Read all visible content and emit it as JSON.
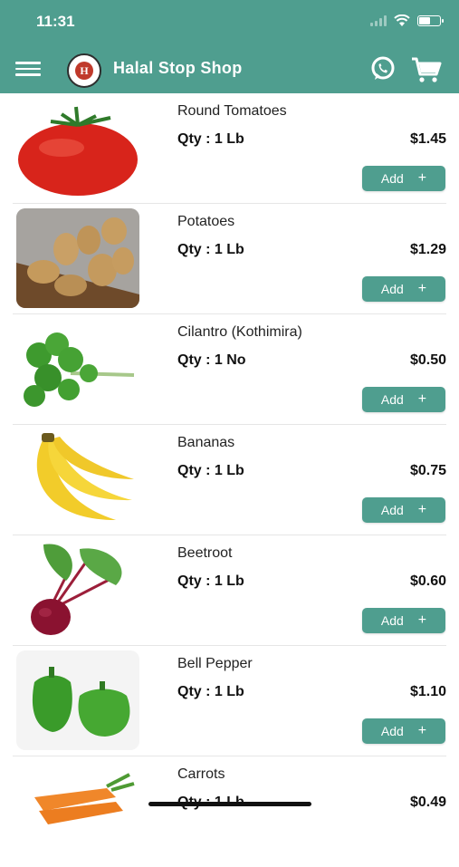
{
  "status_bar": {
    "time": "11:31"
  },
  "header": {
    "title": "Halal Stop Shop",
    "logo_letter": "H"
  },
  "products": [
    {
      "name": "Round Tomatoes",
      "qty": "Qty : 1 Lb",
      "price": "$1.45",
      "add_label": "Add",
      "add_icon": "+"
    },
    {
      "name": "Potatoes",
      "qty": "Qty : 1 Lb",
      "price": "$1.29",
      "add_label": "Add",
      "add_icon": "+"
    },
    {
      "name": "Cilantro (Kothimira)",
      "qty": "Qty : 1 No",
      "price": "$0.50",
      "add_label": "Add",
      "add_icon": "+"
    },
    {
      "name": "Bananas",
      "qty": "Qty : 1 Lb",
      "price": "$0.75",
      "add_label": "Add",
      "add_icon": "+"
    },
    {
      "name": "Beetroot",
      "qty": "Qty : 1 Lb",
      "price": "$0.60",
      "add_label": "Add",
      "add_icon": "+"
    },
    {
      "name": "Bell Pepper",
      "qty": "Qty : 1 Lb",
      "price": "$1.10",
      "add_label": "Add",
      "add_icon": "+"
    },
    {
      "name": "Carrots",
      "qty": "Qty : 1 Lb",
      "price": "$0.49"
    }
  ],
  "colors": {
    "primary": "#4f9e8f"
  }
}
